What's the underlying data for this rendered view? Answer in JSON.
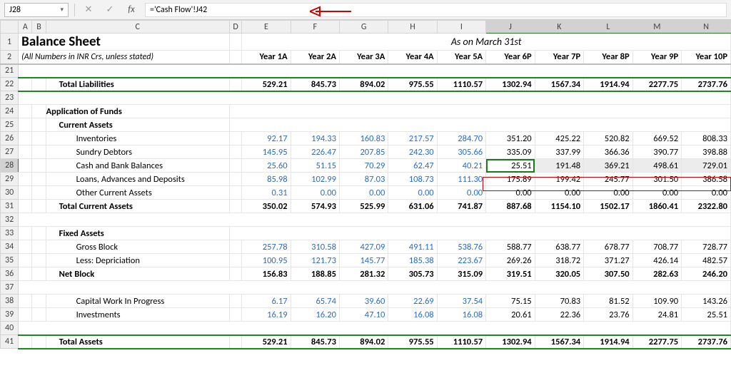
{
  "namebox": {
    "value": "J28",
    "dropdown_glyph": "▾"
  },
  "fbar": {
    "cancel_glyph": "✕",
    "accept_glyph": "✓",
    "fx_label": "fx",
    "formula": "='Cash Flow'!J42"
  },
  "columns": [
    "A",
    "B",
    "C",
    "D",
    "E",
    "F",
    "G",
    "H",
    "I",
    "J",
    "K",
    "L",
    "M",
    "N"
  ],
  "row_numbers": [
    "1",
    "2",
    "21",
    "22",
    "23",
    "24",
    "25",
    "26",
    "27",
    "28",
    "29",
    "30",
    "31",
    "32",
    "33",
    "34",
    "35",
    "36",
    "37",
    "38",
    "39",
    "40",
    "41"
  ],
  "header": {
    "title": "Balance Sheet",
    "subtitle": "(All Numbers in INR Crs, unless stated)",
    "as_on": "As on March 31st",
    "years": [
      "Year 1A",
      "Year 2A",
      "Year 3A",
      "Year 4A",
      "Year 5A",
      "Year 6P",
      "Year 7P",
      "Year 8P",
      "Year 9P",
      "Year 10P"
    ]
  },
  "row22": {
    "label": "Total Liabilities",
    "vals": [
      "529.21",
      "845.73",
      "894.02",
      "975.55",
      "1110.57",
      "1302.94",
      "1567.34",
      "1914.94",
      "2277.75",
      "2737.76"
    ]
  },
  "row24": {
    "label": "Application of Funds"
  },
  "row25": {
    "label": "Current Assets"
  },
  "row26": {
    "label": "Inventories",
    "vals": [
      "92.17",
      "194.33",
      "160.83",
      "217.57",
      "284.70",
      "351.20",
      "425.22",
      "520.82",
      "669.52",
      "808.33"
    ]
  },
  "row27": {
    "label": "Sundry Debtors",
    "vals": [
      "145.95",
      "226.47",
      "207.85",
      "242.30",
      "305.66",
      "335.09",
      "337.99",
      "366.36",
      "390.77",
      "398.88"
    ]
  },
  "row28": {
    "label": "Cash and Bank Balances",
    "vals": [
      "25.60",
      "51.15",
      "70.29",
      "62.47",
      "40.21",
      "25.51",
      "191.48",
      "369.21",
      "498.61",
      "729.01"
    ]
  },
  "row29": {
    "label": "Loans, Advances and Deposits",
    "vals": [
      "85.98",
      "102.99",
      "87.03",
      "108.73",
      "111.30",
      "175.89",
      "199.42",
      "245.77",
      "301.50",
      "386.58"
    ]
  },
  "row30": {
    "label": "Other Current Assets",
    "vals": [
      "0.31",
      "0.00",
      "0.00",
      "0.00",
      "0.00",
      "0.00",
      "0.00",
      "0.00",
      "0.00",
      "0.00"
    ]
  },
  "row31": {
    "label": "Total Current Assets",
    "vals": [
      "350.02",
      "574.93",
      "525.99",
      "631.06",
      "741.87",
      "887.68",
      "1154.10",
      "1502.17",
      "1860.41",
      "2322.80"
    ]
  },
  "row33": {
    "label": "Fixed Assets"
  },
  "row34": {
    "label": "Gross Block",
    "vals": [
      "257.78",
      "310.58",
      "427.09",
      "491.11",
      "538.76",
      "588.77",
      "638.77",
      "678.77",
      "708.77",
      "728.77"
    ]
  },
  "row35": {
    "label": "Less: Depriciation",
    "vals": [
      "100.95",
      "121.73",
      "145.77",
      "185.38",
      "223.67",
      "269.26",
      "318.72",
      "371.27",
      "426.14",
      "482.57"
    ]
  },
  "row36": {
    "label": "Net Block",
    "vals": [
      "156.83",
      "188.85",
      "281.32",
      "305.73",
      "315.09",
      "319.51",
      "320.05",
      "307.50",
      "282.63",
      "246.20"
    ]
  },
  "row38": {
    "label": "Capital Work In Progress",
    "vals": [
      "6.17",
      "65.74",
      "39.60",
      "22.69",
      "37.54",
      "75.15",
      "70.83",
      "81.52",
      "109.90",
      "143.26"
    ]
  },
  "row39": {
    "label": "Investments",
    "vals": [
      "16.19",
      "16.20",
      "47.10",
      "16.08",
      "16.08",
      "20.61",
      "22.36",
      "23.76",
      "24.81",
      "25.51"
    ]
  },
  "row41": {
    "label": "Total Assets",
    "vals": [
      "529.21",
      "845.73",
      "894.02",
      "975.55",
      "1110.57",
      "1302.94",
      "1567.34",
      "1914.94",
      "2277.75",
      "2737.76"
    ]
  },
  "chart_data": {
    "type": "table",
    "title": "Balance Sheet",
    "subtitle_note": "As on March 31st; All Numbers in INR Crs, unless stated",
    "columns": [
      "Year 1A",
      "Year 2A",
      "Year 3A",
      "Year 4A",
      "Year 5A",
      "Year 6P",
      "Year 7P",
      "Year 8P",
      "Year 9P",
      "Year 10P"
    ],
    "rows": [
      {
        "label": "Total Liabilities",
        "values": [
          529.21,
          845.73,
          894.02,
          975.55,
          1110.57,
          1302.94,
          1567.34,
          1914.94,
          2277.75,
          2737.76
        ]
      },
      {
        "label": "Inventories",
        "values": [
          92.17,
          194.33,
          160.83,
          217.57,
          284.7,
          351.2,
          425.22,
          520.82,
          669.52,
          808.33
        ]
      },
      {
        "label": "Sundry Debtors",
        "values": [
          145.95,
          226.47,
          207.85,
          242.3,
          305.66,
          335.09,
          337.99,
          366.36,
          390.77,
          398.88
        ]
      },
      {
        "label": "Cash and Bank Balances",
        "values": [
          25.6,
          51.15,
          70.29,
          62.47,
          40.21,
          25.51,
          191.48,
          369.21,
          498.61,
          729.01
        ]
      },
      {
        "label": "Loans, Advances and Deposits",
        "values": [
          85.98,
          102.99,
          87.03,
          108.73,
          111.3,
          175.89,
          199.42,
          245.77,
          301.5,
          386.58
        ]
      },
      {
        "label": "Other Current Assets",
        "values": [
          0.31,
          0.0,
          0.0,
          0.0,
          0.0,
          0.0,
          0.0,
          0.0,
          0.0,
          0.0
        ]
      },
      {
        "label": "Total Current Assets",
        "values": [
          350.02,
          574.93,
          525.99,
          631.06,
          741.87,
          887.68,
          1154.1,
          1502.17,
          1860.41,
          2322.8
        ]
      },
      {
        "label": "Gross Block",
        "values": [
          257.78,
          310.58,
          427.09,
          491.11,
          538.76,
          588.77,
          638.77,
          678.77,
          708.77,
          728.77
        ]
      },
      {
        "label": "Less: Depriciation",
        "values": [
          100.95,
          121.73,
          145.77,
          185.38,
          223.67,
          269.26,
          318.72,
          371.27,
          426.14,
          482.57
        ]
      },
      {
        "label": "Net Block",
        "values": [
          156.83,
          188.85,
          281.32,
          305.73,
          315.09,
          319.51,
          320.05,
          307.5,
          282.63,
          246.2
        ]
      },
      {
        "label": "Capital Work In Progress",
        "values": [
          6.17,
          65.74,
          39.6,
          22.69,
          37.54,
          75.15,
          70.83,
          81.52,
          109.9,
          143.26
        ]
      },
      {
        "label": "Investments",
        "values": [
          16.19,
          16.2,
          47.1,
          16.08,
          16.08,
          20.61,
          22.36,
          23.76,
          24.81,
          25.51
        ]
      },
      {
        "label": "Total Assets",
        "values": [
          529.21,
          845.73,
          894.02,
          975.55,
          1110.57,
          1302.94,
          1567.34,
          1914.94,
          2277.75,
          2737.76
        ]
      }
    ]
  }
}
